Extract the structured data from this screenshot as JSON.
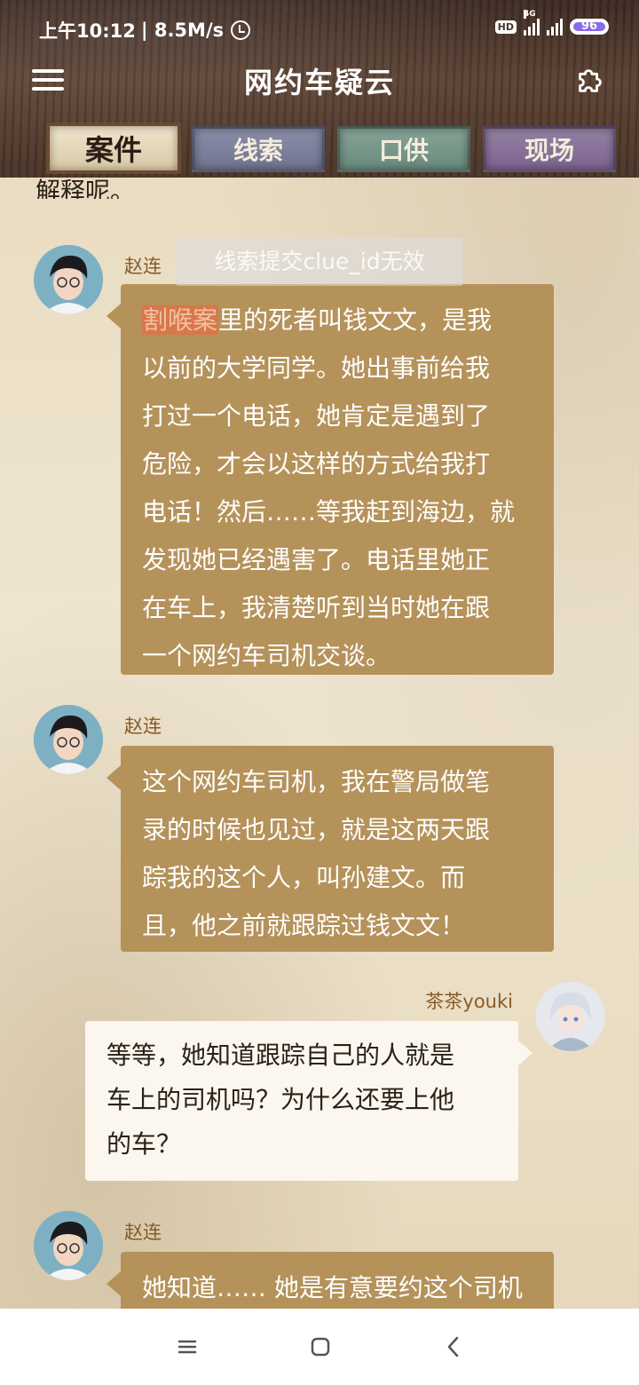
{
  "status_bar": {
    "time": "上午10:12",
    "speed": "| 8.5M/s",
    "hd": "HD",
    "network": "4G",
    "battery": "96"
  },
  "app": {
    "title": "网约车疑云"
  },
  "tabs": [
    {
      "label": "案件",
      "active": true
    },
    {
      "label": "线索",
      "active": false
    },
    {
      "label": "口供",
      "active": false
    },
    {
      "label": "现场",
      "active": false
    }
  ],
  "chat": {
    "cut_text": "解释呢。",
    "toast": "线索提交clue_id无效",
    "messages": [
      {
        "sender": "赵连",
        "keyword": "割喉案",
        "lines": [
          "里的死者叫钱文文，是我",
          "以前的大学同学。她出事前给我",
          "打过一个电话，她肯定是遇到了",
          "危险，才会以这样的方式给我打",
          "电话！然后……等我赶到海边，就",
          "发现她已经遇害了。电话里她正",
          "在车上，我清楚听到当时她在跟",
          "一个网约车司机交谈。"
        ]
      },
      {
        "sender": "赵连",
        "lines": [
          "这个网约车司机，我在警局做笔",
          "录的时候也见过，就是这两天跟",
          "踪我的这个人，叫孙建文。而",
          "且，他之前就跟踪过钱文文！"
        ]
      },
      {
        "sender": "茶茶youki",
        "lines": [
          "等等，她知道跟踪自己的人就是",
          "车上的司机吗？为什么还要上他",
          "的车？"
        ]
      },
      {
        "sender": "赵连",
        "lines": [
          "她知道…… 她是有意要约这个司机"
        ]
      }
    ]
  }
}
